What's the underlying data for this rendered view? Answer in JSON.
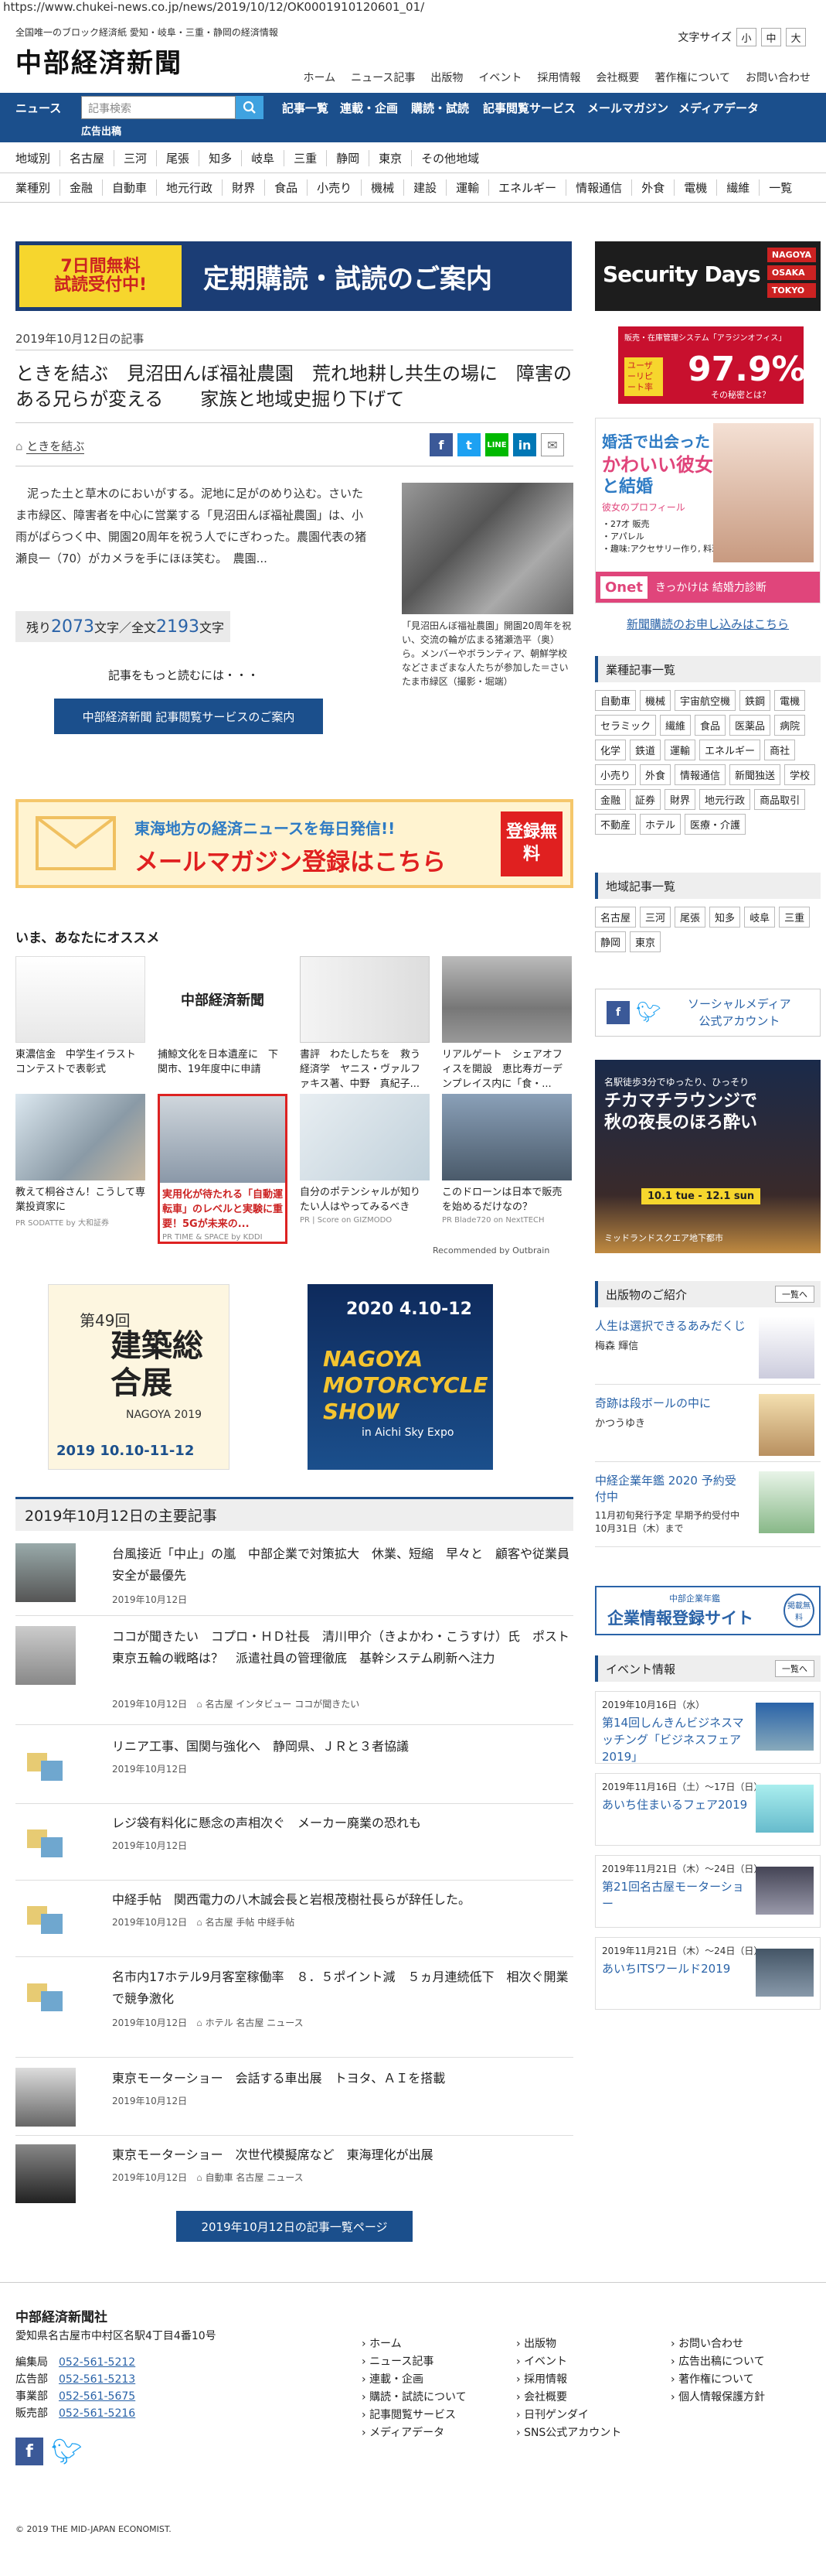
{
  "url": "https://www.chukei-news.co.jp/news/2019/10/12/OK0001910120601_01/",
  "header": {
    "tagline": "全国唯一のブロック経済紙 愛知・岐阜・三重・静岡の経済情報",
    "logo": "中部経済新聞",
    "font_size_label": "文字サイズ",
    "font_sizes": [
      "小",
      "中",
      "大"
    ],
    "top_links": [
      "ホーム",
      "ニュース記事",
      "出版物",
      "イベント",
      "採用情報",
      "会社概要",
      "著作権について",
      "お問い合わせ"
    ]
  },
  "mainnav": {
    "news": "ニュース",
    "search_placeholder": "記事検索",
    "items": [
      "記事一覧",
      "連載・企画",
      "購読・試読",
      "記事閲覧サービス",
      "メールマガジン",
      "メディアデータ"
    ],
    "ads": "広告出稿"
  },
  "region_bar": {
    "label": "地域別",
    "items": [
      "名古屋",
      "三河",
      "尾張",
      "知多",
      "岐阜",
      "三重",
      "静岡",
      "東京",
      "その他地域"
    ]
  },
  "industry_bar": {
    "label": "業種別",
    "items": [
      "金融",
      "自動車",
      "地元行政",
      "財界",
      "食品",
      "小売り",
      "機械",
      "建設",
      "運輸",
      "エネルギー",
      "情報通信",
      "外食",
      "電機",
      "繊維",
      "一覧"
    ]
  },
  "promo": {
    "badge_line1": "7日間無料",
    "badge_line2": "試読受付中!",
    "text": "定期購読・試読のご案内"
  },
  "article": {
    "date": "2019年10月12日の記事",
    "title": "ときを結ぶ　見沼田んぼ福祉農園　荒れ地耕し共生の場に　障害のある兄らが変える　　家族と地域史掘り下げて",
    "tag": "ときを結ぶ",
    "body": "　泥った土と草木のにおいがする。泥地に足がのめり込む。さいたま市緑区、障害者を中心に営業する「見沼田んぼ福祉農園」は、小雨がぱらつく中、開園20周年を祝う人でにぎわった。農園代表の猪瀬良一（70）がカメラを手にほほ笑む。　農園...",
    "caption": "「見沼田んぼ福祉農園」開園20周年を祝い、交流の輪が広まる猪瀬浩平（奥）ら。メンバーやボランティア、朝鮮学校などさまざまな人たちが参加した＝さいたま市緑区（撮影・堀端）",
    "remaining_label": "残り",
    "remaining": "2073",
    "chars_unit": "文字",
    "total_label": "／全文",
    "total": "2193",
    "more_text": "記事をもっと読むには・・・",
    "more_button": "中部経済新聞 記事閲覧サービスのご案内"
  },
  "mail_banner": {
    "line1": "東海地方の経済ニュースを毎日発信!!",
    "line2": "メールマガジン登録はこちら",
    "badge": "登録無料"
  },
  "recommend": {
    "heading": "いま、あなたにオススメ",
    "items": [
      {
        "text": "東濃信金　中学生イラストコンテストで表彰式",
        "pr": ""
      },
      {
        "text": "捕鯨文化を日本遺産に　下関市、19年度中に申請",
        "pr": ""
      },
      {
        "text": "書評　わたしたちを　救う経済学　ヤニス・ヴァルファキス著、中野　真紀子...",
        "pr": ""
      },
      {
        "text": "リアルゲート　シェアオフィスを開設　恵比寿ガーデンプレイス内に「食・...",
        "pr": ""
      },
      {
        "text": "教えて桐谷さん！こうして専業投資家に",
        "pr": "PR SODATTE by 大和証券"
      },
      {
        "text": "実用化が待たれる「自動運転車」のレベルと実験に重要！5Gが未来の...",
        "pr": "PR TIME & SPACE by KDDI"
      },
      {
        "text": "自分のポテンシャルが知りたい人はやってみるべき",
        "pr": "PR | Score on GIZMODO"
      },
      {
        "text": "このドローンは日本で販売を始めるだけなの？",
        "pr": "PR Blade720 on NextTECH"
      }
    ],
    "recommended_by": "Recommended by Outbrain"
  },
  "banners": {
    "kenchiku": {
      "num": "第49回",
      "title": "建築総合展",
      "sub": "NAGOYA 2019",
      "dates": "2019 10.10-11-12"
    },
    "moto": {
      "dates": "2020 4.10-12",
      "title": "NAGOYA MOTORCYCLE SHOW",
      "sub": "in Aichi Sky Expo"
    }
  },
  "articles": {
    "heading": "2019年10月12日の主要記事",
    "items": [
      {
        "title": "台風接近「中止」の嵐　中部企業で対策拡大　休業、短縮　早々と　顧客や従業員　安全が最優先",
        "date": "2019年10月12日",
        "tags": ""
      },
      {
        "title": "ココが聞きたい　コプロ・ＨＤ社長　清川甲介（きよかわ・こうすけ）氏　ポスト東京五輪の戦略は？　派遣社員の管理徹底　基幹システム刷新へ注力",
        "date": "2019年10月12日",
        "tags": "名古屋 インタビュー ココが聞きたい"
      },
      {
        "title": "リニア工事、国関与強化へ　静岡県、ＪＲと３者協議",
        "date": "2019年10月12日",
        "tags": ""
      },
      {
        "title": "レジ袋有料化に懸念の声相次ぐ　メーカー廃業の恐れも",
        "date": "2019年10月12日",
        "tags": ""
      },
      {
        "title": "中経手帖　関西電力の八木誠会長と岩根茂樹社長らが辞任した。",
        "date": "2019年10月12日",
        "tags": "名古屋 手帖 中経手帖"
      },
      {
        "title": "名市内17ホテル9月客室稼働率　８．５ポイント減　５ヵ月連続低下　相次ぐ開業で競争激化",
        "date": "2019年10月12日",
        "tags": "ホテル 名古屋 ニュース"
      },
      {
        "title": "東京モーターショー　会話する車出展　トヨタ、ＡＩを搭載",
        "date": "2019年10月12日",
        "tags": ""
      },
      {
        "title": "東京モーターショー　次世代模擬席など　東海理化が出展",
        "date": "2019年10月12日",
        "tags": "自動車 名古屋 ニュース"
      }
    ],
    "list_button": "2019年10月12日の記事一覧ページ"
  },
  "sidebar": {
    "security": {
      "title": "Security Days",
      "cities": [
        "NAGOYA",
        "OSAKA",
        "TOKYO"
      ]
    },
    "pc_ad": {
      "top": "販売・在庫管理システム「アラジンオフィス」",
      "label": "ユーザーリピート率",
      "value": "97.9%",
      "sub": "その秘密とは？"
    },
    "onet": {
      "line1": "婚活で出会った",
      "line2": "かわいい彼女",
      "line3": "と結婚",
      "profile": "彼女のプロフィール",
      "p1": "・27才 販売",
      "p2": "・アパレル",
      "p3": "・趣味:アクセサリー作り, 料理",
      "brand": "Onet",
      "cta": "きっかけは 結婚力診断"
    },
    "subscribe_link": "新聞購読のお申し込みはこちら",
    "industry": {
      "heading": "業種記事一覧",
      "items": [
        "自動車",
        "機械",
        "宇宙航空機",
        "鉄鋼",
        "電機",
        "セラミック",
        "繊維",
        "食品",
        "医薬品",
        "病院",
        "化学",
        "鉄道",
        "運輸",
        "エネルギー",
        "商社",
        "小売り",
        "外食",
        "情報通信",
        "新聞独送",
        "学校",
        "金融",
        "証券",
        "財界",
        "地元行政",
        "商品取引",
        "不動産",
        "ホテル",
        "医療・介護"
      ]
    },
    "region": {
      "heading": "地域記事一覧",
      "items": [
        "名古屋",
        "三河",
        "尾張",
        "知多",
        "岐阜",
        "三重",
        "静岡",
        "東京"
      ]
    },
    "social": {
      "line1": "ソーシャルメディア",
      "line2": "公式アカウント"
    },
    "chika": {
      "top": "名駅徒歩3分でゆったり、ひっそり",
      "title": "チカマチラウンジで秋の夜長のほろ酔い",
      "dates": "10.1 tue - 12.1 sun",
      "foot": "ミッドランドスクエア地下都市"
    },
    "pubs": {
      "heading": "出版物のご紹介",
      "more": "一覧へ",
      "items": [
        {
          "title": "人生は選択できるあみだくじ",
          "author": "梅森 輝信"
        },
        {
          "title": "奇跡は段ボールの中に",
          "author": "かつうゆき"
        },
        {
          "title": "中経企業年鑑 2020 予約受付中",
          "author": "11月初旬発行予定 早期予約受付中10月31日（木）まで"
        }
      ]
    },
    "corp_banner": {
      "small": "中部企業年鑑",
      "main": "企業情報登録サイト",
      "badge": "掲載無料"
    },
    "events": {
      "heading": "イベント情報",
      "more": "一覧へ",
      "items": [
        {
          "date": "2019年10月16日（水）",
          "title": "第14回しんきんビジネスマッチング「ビジネスフェア2019」"
        },
        {
          "date": "2019年11月16日（土）〜17日（日）",
          "title": "あいち住まいるフェア2019"
        },
        {
          "date": "2019年11月21日（木）〜24日（日）",
          "title": "第21回名古屋モーターショー"
        },
        {
          "date": "2019年11月21日（木）〜24日（日）",
          "title": "あいちITSワールド2019"
        }
      ]
    }
  },
  "footer": {
    "company": "中部経済新聞社",
    "address": "愛知県名古屋市中村区名駅4丁目4番10号",
    "phones": [
      {
        "label": "編集局",
        "num": "052-561-5212"
      },
      {
        "label": "広告部",
        "num": "052-561-5213"
      },
      {
        "label": "事業部",
        "num": "052-561-5675"
      },
      {
        "label": "販売部",
        "num": "052-561-5216"
      }
    ],
    "col1": [
      "ホーム",
      "ニュース記事",
      "連載・企画",
      "購読・試読について",
      "記事閲覧サービス",
      "メディアデータ"
    ],
    "col2": [
      "出版物",
      "イベント",
      "採用情報",
      "会社概要",
      "日刊ゲンダイ",
      "SNS公式アカウント"
    ],
    "col3": [
      "お問い合わせ",
      "広告出稿について",
      "著作権について",
      "個人情報保護方針"
    ],
    "copyright": "© 2019 THE MID-JAPAN ECONOMIST."
  },
  "colors": {
    "navy": "#1b4f8c",
    "link": "#2a63a8",
    "accent": "#e02020"
  }
}
